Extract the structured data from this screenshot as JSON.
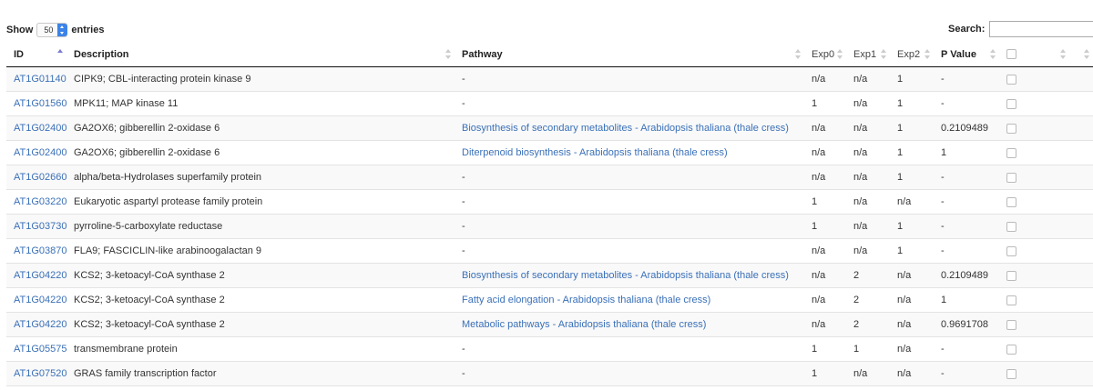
{
  "controls": {
    "show_label": "Show",
    "entries_label": "entries",
    "page_length": "50",
    "search_label": "Search:",
    "search_value": ""
  },
  "columns": {
    "id": "ID",
    "description": "Description",
    "pathway": "Pathway",
    "exp0": "Exp0",
    "exp1": "Exp1",
    "exp2": "Exp2",
    "pvalue": "P Value"
  },
  "rows": [
    {
      "id": "AT1G01140",
      "description": "CIPK9; CBL-interacting protein kinase 9",
      "pathway": "-",
      "pathway_link": false,
      "exp0": "n/a",
      "exp1": "n/a",
      "exp2": "1",
      "pvalue": "-"
    },
    {
      "id": "AT1G01560",
      "description": "MPK11; MAP kinase 11",
      "pathway": "-",
      "pathway_link": false,
      "exp0": "1",
      "exp1": "n/a",
      "exp2": "1",
      "pvalue": "-"
    },
    {
      "id": "AT1G02400",
      "description": "GA2OX6; gibberellin 2-oxidase 6",
      "pathway": "Biosynthesis of secondary metabolites - Arabidopsis thaliana (thale cress)",
      "pathway_link": true,
      "exp0": "n/a",
      "exp1": "n/a",
      "exp2": "1",
      "pvalue": "0.2109489"
    },
    {
      "id": "AT1G02400",
      "description": "GA2OX6; gibberellin 2-oxidase 6",
      "pathway": "Diterpenoid biosynthesis - Arabidopsis thaliana (thale cress)",
      "pathway_link": true,
      "exp0": "n/a",
      "exp1": "n/a",
      "exp2": "1",
      "pvalue": "1"
    },
    {
      "id": "AT1G02660",
      "description": "alpha/beta-Hydrolases superfamily protein",
      "pathway": "-",
      "pathway_link": false,
      "exp0": "n/a",
      "exp1": "n/a",
      "exp2": "1",
      "pvalue": "-"
    },
    {
      "id": "AT1G03220",
      "description": "Eukaryotic aspartyl protease family protein",
      "pathway": "-",
      "pathway_link": false,
      "exp0": "1",
      "exp1": "n/a",
      "exp2": "n/a",
      "pvalue": "-"
    },
    {
      "id": "AT1G03730",
      "description": "pyrroline-5-carboxylate reductase",
      "pathway": "-",
      "pathway_link": false,
      "exp0": "1",
      "exp1": "n/a",
      "exp2": "1",
      "pvalue": "-"
    },
    {
      "id": "AT1G03870",
      "description": "FLA9; FASCICLIN-like arabinoogalactan 9",
      "pathway": "-",
      "pathway_link": false,
      "exp0": "n/a",
      "exp1": "n/a",
      "exp2": "1",
      "pvalue": "-"
    },
    {
      "id": "AT1G04220",
      "description": "KCS2; 3-ketoacyl-CoA synthase 2",
      "pathway": "Biosynthesis of secondary metabolites - Arabidopsis thaliana (thale cress)",
      "pathway_link": true,
      "exp0": "n/a",
      "exp1": "2",
      "exp2": "n/a",
      "pvalue": "0.2109489"
    },
    {
      "id": "AT1G04220",
      "description": "KCS2; 3-ketoacyl-CoA synthase 2",
      "pathway": "Fatty acid elongation - Arabidopsis thaliana (thale cress)",
      "pathway_link": true,
      "exp0": "n/a",
      "exp1": "2",
      "exp2": "n/a",
      "pvalue": "1"
    },
    {
      "id": "AT1G04220",
      "description": "KCS2; 3-ketoacyl-CoA synthase 2",
      "pathway": "Metabolic pathways - Arabidopsis thaliana (thale cress)",
      "pathway_link": true,
      "exp0": "n/a",
      "exp1": "2",
      "exp2": "n/a",
      "pvalue": "0.9691708"
    },
    {
      "id": "AT1G05575",
      "description": "transmembrane protein",
      "pathway": "-",
      "pathway_link": false,
      "exp0": "1",
      "exp1": "1",
      "exp2": "n/a",
      "pvalue": "-"
    },
    {
      "id": "AT1G07520",
      "description": "GRAS family transcription factor",
      "pathway": "-",
      "pathway_link": false,
      "exp0": "1",
      "exp1": "n/a",
      "exp2": "n/a",
      "pvalue": "-"
    }
  ]
}
